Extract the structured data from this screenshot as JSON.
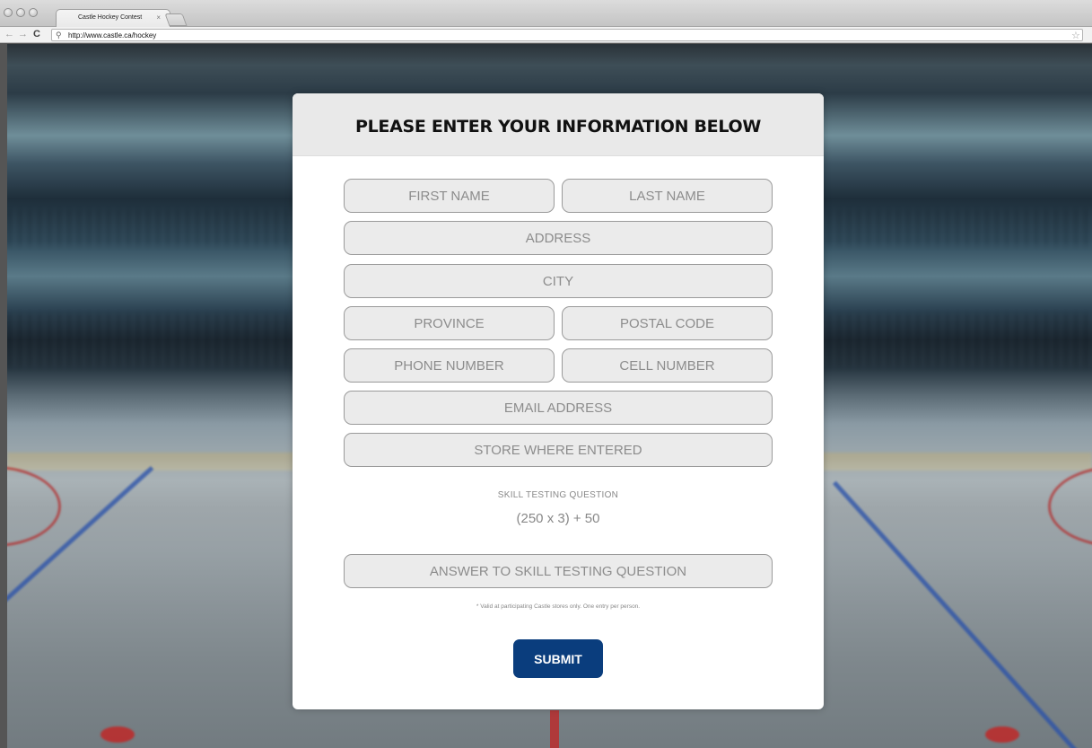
{
  "browser": {
    "tab_title": "Castle Hockey Contest",
    "tab_close": "×",
    "url": "http://www.castle.ca/hockey",
    "icons": {
      "back": "back-arrow-icon",
      "forward": "forward-arrow-icon",
      "reload": "reload-icon",
      "search": "search-icon",
      "bookmark": "star-icon"
    }
  },
  "form": {
    "title": "PLEASE ENTER YOUR INFORMATION BELOW",
    "fields": {
      "first_name": "FIRST NAME",
      "last_name": "LAST NAME",
      "address": "ADDRESS",
      "city": "CITY",
      "province": "PROVINCE",
      "postal_code": "POSTAL CODE",
      "phone_number": "PHONE NUMBER",
      "cell_number": "CELL NUMBER",
      "email_address": "EMAIL ADDRESS",
      "store": "STORE WHERE ENTERED",
      "answer": "ANSWER TO SKILL TESTING QUESTION"
    },
    "skill_label": "SKILL TESTING QUESTION",
    "skill_question": "(250 x 3) + 50",
    "disclaimer": "* Valid at participating Castle stores only. One entry per person.",
    "submit_label": "SUBMIT"
  },
  "colors": {
    "submit_button": "#0a3d7d",
    "header_band": "#e9e9e9",
    "field_background": "#ebebeb"
  }
}
